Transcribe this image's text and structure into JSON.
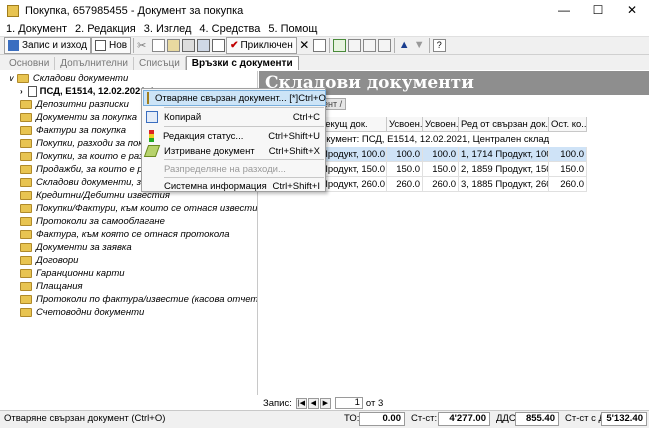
{
  "window": {
    "title": "Покупка, 657985455 - Документ за покупка"
  },
  "menu": [
    "1. Документ",
    "2. Редакция",
    "3. Изглед",
    "4. Средства",
    "5. Помощ"
  ],
  "toolbar": {
    "save_label": "Запис и изход",
    "new_label": "Нов",
    "confirm_label": "Приключен"
  },
  "tabs": [
    "Основни",
    "Допълнителни",
    "Списъци",
    "Връзки с документи"
  ],
  "tree": {
    "root": "Складови документи",
    "selected": "ПСД, Е1514, 12.02.2021, |",
    "items": [
      "Депозитни разписки",
      "Документи за покупка",
      "Фактури за покупка",
      "Покупки, разходи за покупка",
      "Покупки, за които е разход",
      "Продажби, за които е разход",
      "Складови документи, за",
      "Кредитни/Дебитни известия",
      "Покупки/Фактури, към които се отнася известието",
      "Протоколи за самооблагане",
      "Фактура, към която се отнася протокола",
      "Документи за заявка",
      "Договори",
      "Гаранционни карти",
      "Плащания",
      "Протоколи по фактура/известие (касова отчетност)",
      "Счетоводни документи"
    ]
  },
  "panel": {
    "title": "Складови документи",
    "subtab": "ент /"
  },
  "grid": {
    "headers": [
      "текущ док.",
      "Усвоен...",
      "Усвоен...",
      "Ред от свързан док.",
      "Ост. ко..."
    ],
    "group": "окумент: ПСД, Е1514, 12.02.2021, Централен склад",
    "rows": [
      [
        "Продукт, 100.0...",
        "100.0",
        "100.0",
        "1, 1714 Продукт, 100.0...",
        "100.0"
      ],
      [
        "Продукт, 150.0...",
        "150.0",
        "150.0",
        "2, 1859 Продукт, 150.0...",
        "150.0"
      ],
      [
        "Продукт, 260.0...",
        "260.0",
        "260.0",
        "3, 1885 Продукт, 260.0...",
        "260.0"
      ]
    ]
  },
  "context_menu": [
    {
      "label": "Отваряне свързан документ... [*]",
      "shortcut": "Ctrl+O"
    },
    {
      "label": "Копирай",
      "shortcut": "Ctrl+C"
    },
    {
      "label": "Редакция статус...",
      "shortcut": "Ctrl+Shift+U"
    },
    {
      "label": "Изтриване документ",
      "shortcut": "Ctrl+Shift+X"
    },
    {
      "label": "Разпределяне на разходи...",
      "shortcut": ""
    },
    {
      "label": "Системна информация",
      "shortcut": "Ctrl+Shift+I"
    }
  ],
  "pager": {
    "label": "Запис:",
    "current": "1",
    "of": "от 3"
  },
  "status": {
    "message": "Отваряне свързан документ (Ctrl+O)",
    "to_label": "ТО:",
    "to_value": "0.00",
    "st_label": "Ст-ст:",
    "st_value": "4'277.00",
    "vat_label": "ДДС:",
    "vat_value": "855.40",
    "total_label": "Ст-ст с ДДС:",
    "total_value": "5'132.40"
  }
}
